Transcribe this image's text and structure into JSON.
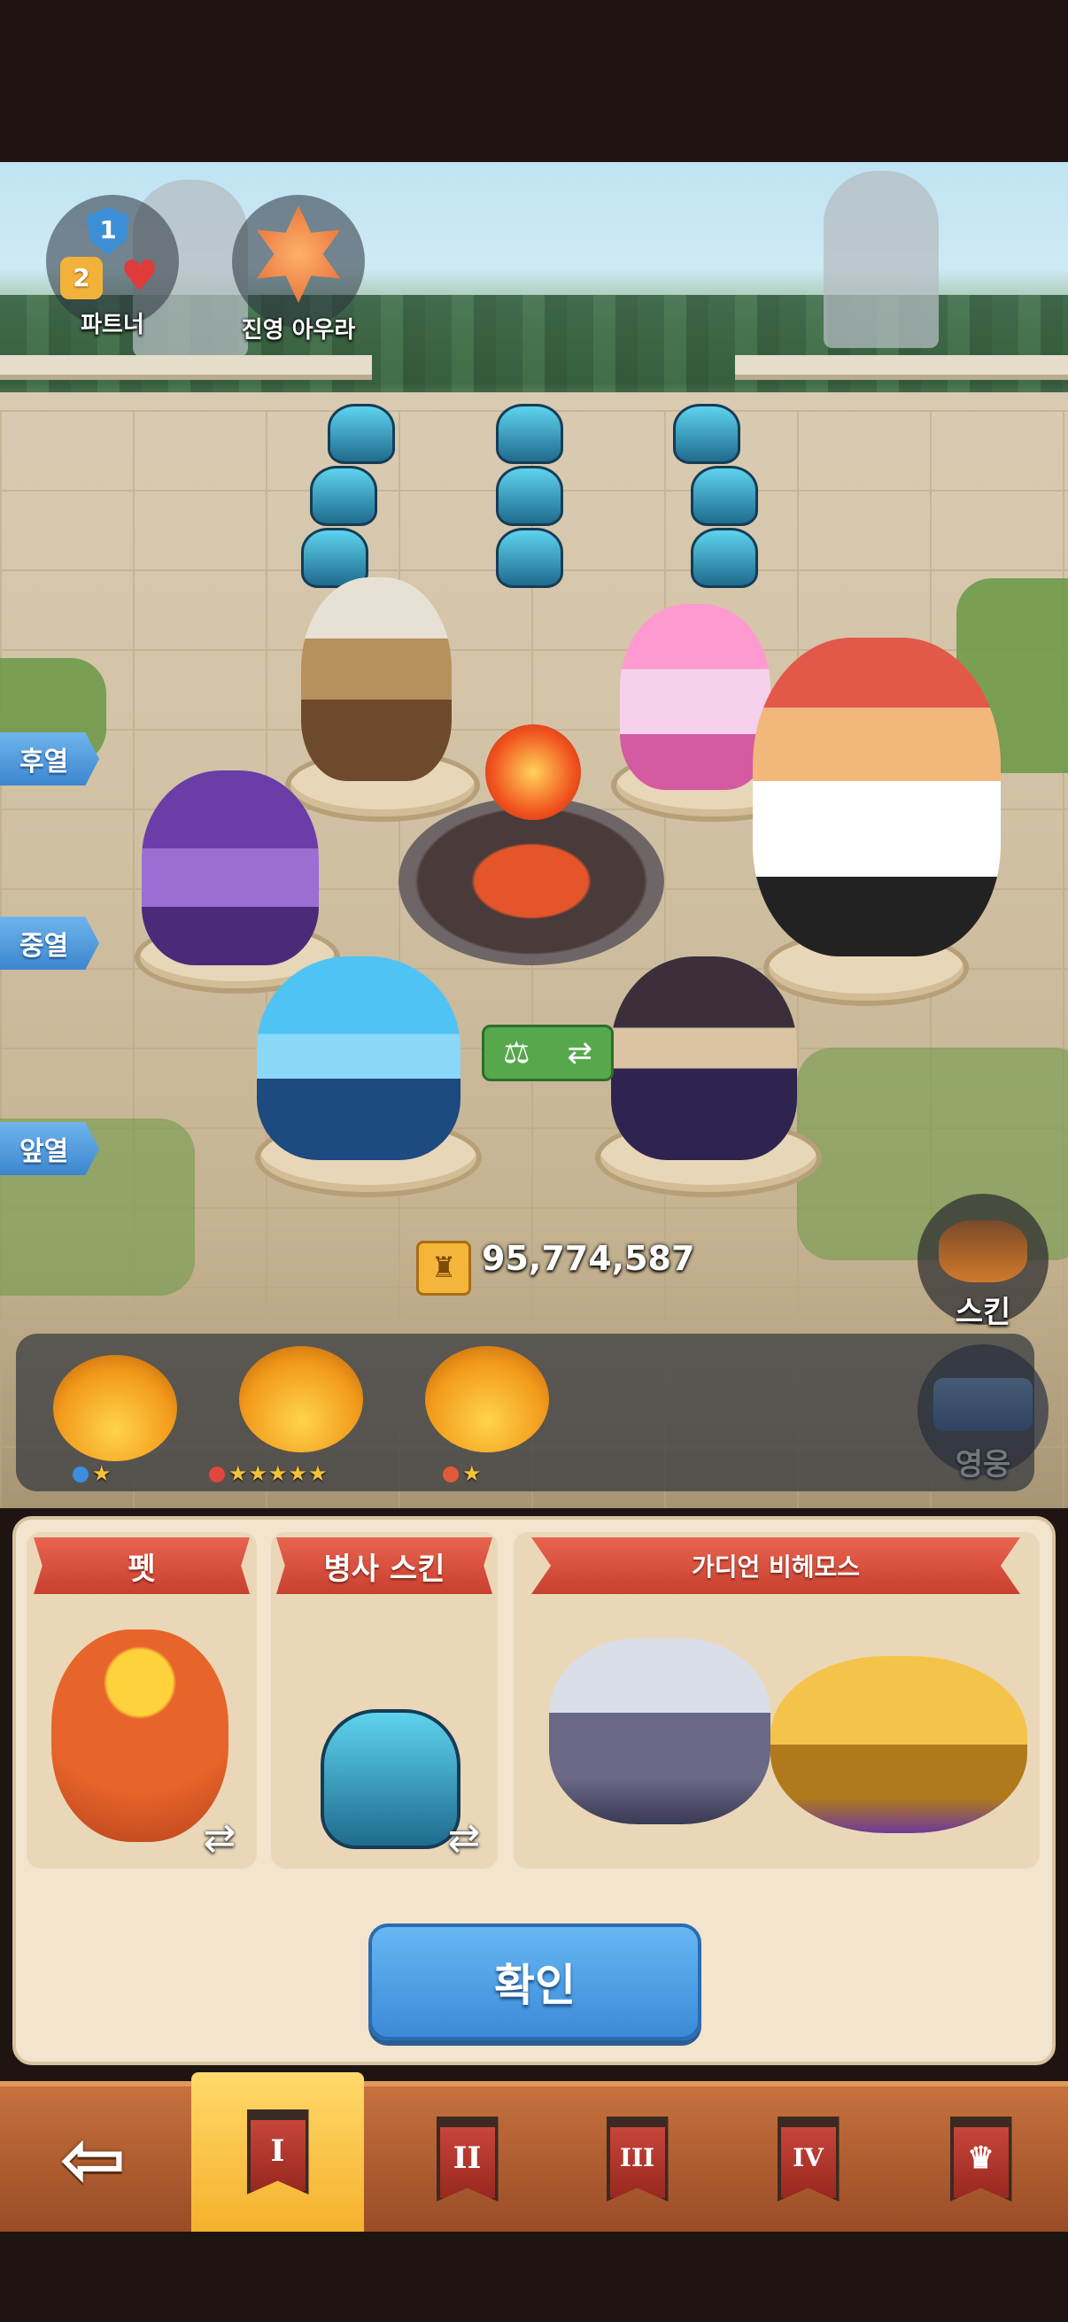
{
  "top_buttons": {
    "partner": {
      "label": "파트너",
      "level_top": "1",
      "level_left": "2"
    },
    "camp_aura": {
      "label": "진영 아우라"
    }
  },
  "row_tags": {
    "back": "후열",
    "middle": "중열",
    "front": "앞열"
  },
  "power": {
    "value": "95,774,587"
  },
  "side_buttons": {
    "skin": "스킨",
    "hero": "영웅"
  },
  "swap_button": {
    "icons": [
      "scale-icon",
      "swap-arrows-icon"
    ]
  },
  "artifacts": [
    {
      "stars": "★",
      "gem_color": "#3a8fe0"
    },
    {
      "stars": "★★★★★",
      "gem_color": "#e0473a"
    },
    {
      "stars": "★",
      "gem_color": "#e05a3a"
    }
  ],
  "panel": {
    "pet_title": "펫",
    "soldier_skin_title": "병사 스킨",
    "guardian_title": "가디언 비헤모스"
  },
  "confirm_label": "확인",
  "tabs": [
    {
      "label": "I",
      "active": true
    },
    {
      "label": "II",
      "active": false
    },
    {
      "label": "III",
      "active": false
    },
    {
      "label": "IV",
      "active": false
    },
    {
      "label": "♛",
      "active": false
    }
  ],
  "colors": {
    "accent_blue": "#3b8ad7",
    "ribbon_red": "#c8402f",
    "tab_active": "#f5b12c",
    "tab_bar": "#9a4c25"
  }
}
